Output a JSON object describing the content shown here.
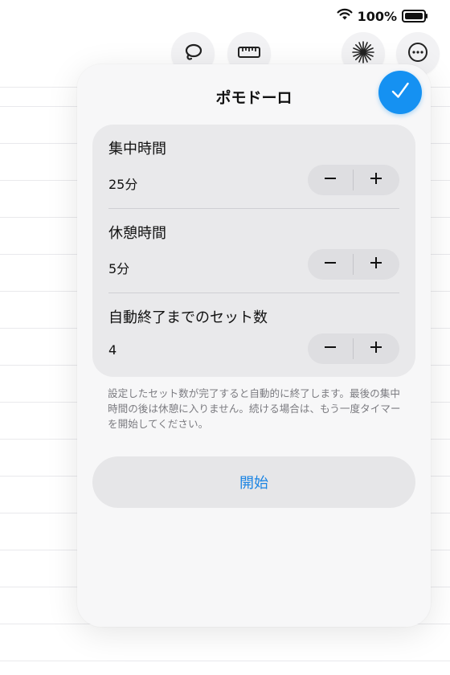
{
  "status_bar": {
    "battery_text": "100%"
  },
  "toolbar": {
    "icons": [
      "lasso-icon",
      "ruler-icon",
      "starburst-icon",
      "more-icon"
    ]
  },
  "popover": {
    "title": "ポモドーロ",
    "rows": [
      {
        "label": "集中時間",
        "value": "25分"
      },
      {
        "label": "休憩時間",
        "value": "5分"
      },
      {
        "label": "自動終了までのセット数",
        "value": "4"
      }
    ],
    "stepper_minus": "−",
    "stepper_plus": "+",
    "note": "設定したセット数が完了すると自動的に終了します。最後の集中時間の後は休憩に入りません。続ける場合は、もう一度タイマーを開始してください。",
    "start_label": "開始"
  },
  "colors": {
    "accent": "#1591f2",
    "link": "#1a84e3"
  }
}
